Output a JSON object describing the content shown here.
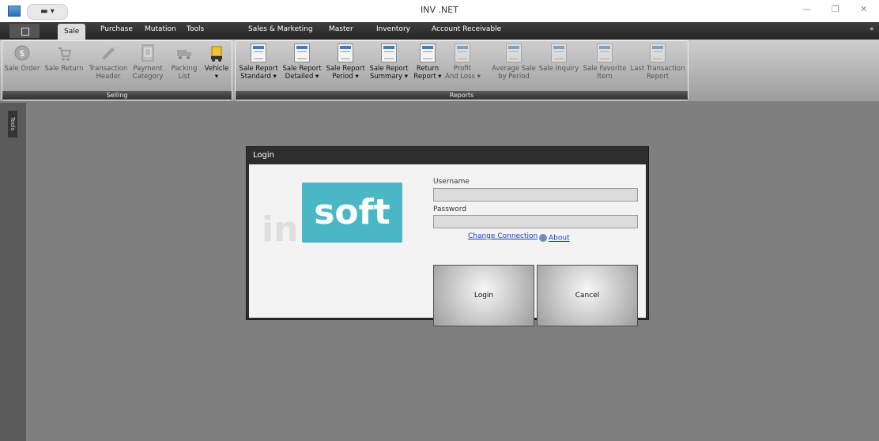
{
  "window": {
    "title": "INV .NET",
    "qat_label": "▬ ▾",
    "collapse_glyph": "«"
  },
  "tabs": [
    "Sale",
    "Purchase",
    "Mutation",
    "Tools",
    "Sales & Marketing",
    "Master",
    "Inventory",
    "Account Receivable"
  ],
  "active_tab": "Sale",
  "ribbon": {
    "selling": {
      "label": "Selling",
      "buttons": [
        {
          "line1": "Sale Order",
          "line2": ""
        },
        {
          "line1": "Sale Return",
          "line2": ""
        },
        {
          "line1": "Transaction",
          "line2": "Header"
        },
        {
          "line1": "Payment",
          "line2": "Category"
        },
        {
          "line1": "Packing",
          "line2": "List"
        },
        {
          "line1": "Vehicle",
          "line2": "▾"
        }
      ]
    },
    "reports": {
      "label": "Reports",
      "buttons": [
        {
          "line1": "Sale Report",
          "line2": "Standard ▾"
        },
        {
          "line1": "Sale Report",
          "line2": "Detailed ▾"
        },
        {
          "line1": "Sale Report",
          "line2": "Period ▾"
        },
        {
          "line1": "Sale Report",
          "line2": "Summary ▾"
        },
        {
          "line1": "Return",
          "line2": "Report ▾"
        },
        {
          "line1": "Profit",
          "line2": "And Loss ▾"
        },
        {
          "line1": "Average Sale",
          "line2": "by Period"
        },
        {
          "line1": "Sale Inquiry",
          "line2": ""
        },
        {
          "line1": "Sale Favorite",
          "line2": "Item"
        },
        {
          "line1": "Last Transaction",
          "line2": "Report"
        }
      ]
    }
  },
  "side_panel": {
    "label": "Tools"
  },
  "login": {
    "title": "Login",
    "logo_text": "soft",
    "logo_ghost": "in",
    "username_label": "Username",
    "username_value": "",
    "password_label": "Password",
    "password_value": "",
    "change_connection": "Change Connection",
    "about": "About",
    "login_button": "Login",
    "cancel_button": "Cancel"
  },
  "colors": {
    "logo_bg": "#4ab8c4",
    "ribbon_group_label_bg": "#3a3a3a",
    "workspace_bg": "#7f7f7f"
  }
}
